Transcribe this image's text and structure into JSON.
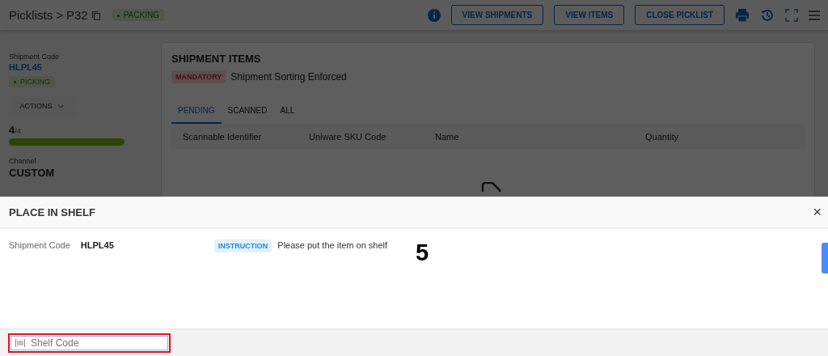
{
  "header": {
    "breadcrumb": "Picklists",
    "separator": ">",
    "current": "P32",
    "status": "PACKING",
    "buttons": [
      "VIEW SHIPMENTS",
      "VIEW ITEMS",
      "CLOSE PICKLIST"
    ]
  },
  "sidebar": {
    "shipment_label": "Shipment Code",
    "shipment_code": "HLPL45",
    "status": "PICKING",
    "actions": "ACTIONS",
    "count": "4",
    "total": "/4",
    "progress": {
      "level": 1
    },
    "channel_label": "Channel",
    "channel": "CUSTOM"
  },
  "card": {
    "title": "SHIPMENT ITEMS",
    "tag": "MANDATORY",
    "tag_text": "Shipment Sorting Enforced",
    "tabs": [
      {
        "label": "PENDING",
        "selected": true
      },
      {
        "label": "SCANNED",
        "selected": false
      },
      {
        "label": "ALL",
        "selected": false
      }
    ],
    "columns": [
      "Scannable Identifier",
      "Uniware SKU Code",
      "Name",
      "Quantity"
    ]
  },
  "dialog": {
    "title": "PLACE IN SHELF",
    "close": "×",
    "field_label": "Shipment Code",
    "field_value": "HLPL45",
    "tag": "INSTRUCTION",
    "instruction": "Please put the item on shelf",
    "number": "5",
    "input": {
      "placeholder": "Shelf Code"
    }
  }
}
